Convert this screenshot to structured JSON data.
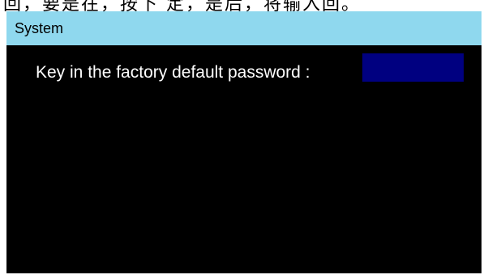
{
  "background_fragment": {
    "text": "回，要是在，按下  定，是后，将输入回。"
  },
  "window": {
    "title": "System"
  },
  "password_prompt": {
    "label": "Key in the factory default password :",
    "value": ""
  },
  "colors": {
    "title_bar": "#8fd8ee",
    "screen_background": "#000000",
    "input_background": "#000080",
    "prompt_text": "#ffffff"
  }
}
